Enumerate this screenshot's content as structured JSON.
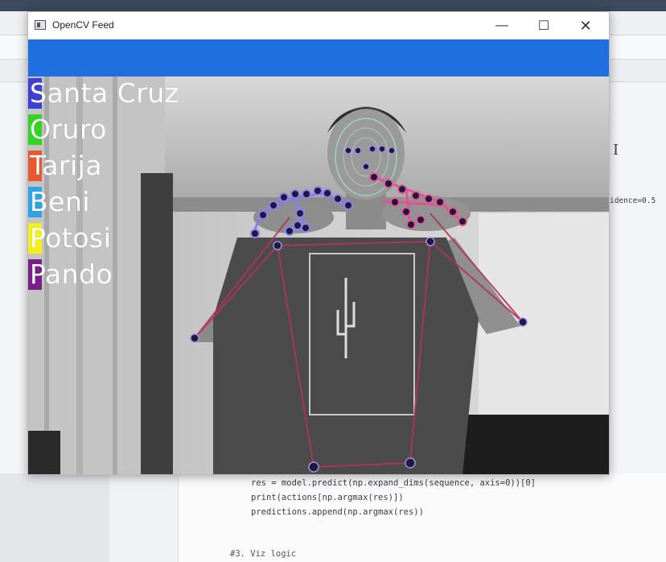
{
  "window": {
    "title": "OpenCV Feed",
    "minimize_glyph": "—",
    "maximize_glyph": "☐",
    "close_glyph": "✕",
    "bar_color": "#1f6fe0"
  },
  "labels": [
    {
      "text": "Santa Cruz",
      "color": "#3f3fd6"
    },
    {
      "text": "Oruro",
      "color": "#33d424"
    },
    {
      "text": "Tarija",
      "color": "#e8582c"
    },
    {
      "text": "Beni",
      "color": "#2ea3e6"
    },
    {
      "text": "Potosi",
      "color": "#f2ef1a"
    },
    {
      "text": "Pando",
      "color": "#7a1f88"
    }
  ],
  "code": {
    "partial_right": "idence=0.5",
    "lines": [
      "res = model.predict(np.expand_dims(sequence, axis=0))[0]",
      "print(actions[np.argmax(res)])",
      "predictions.append(np.argmax(res))",
      "#3. Viz logic"
    ]
  }
}
